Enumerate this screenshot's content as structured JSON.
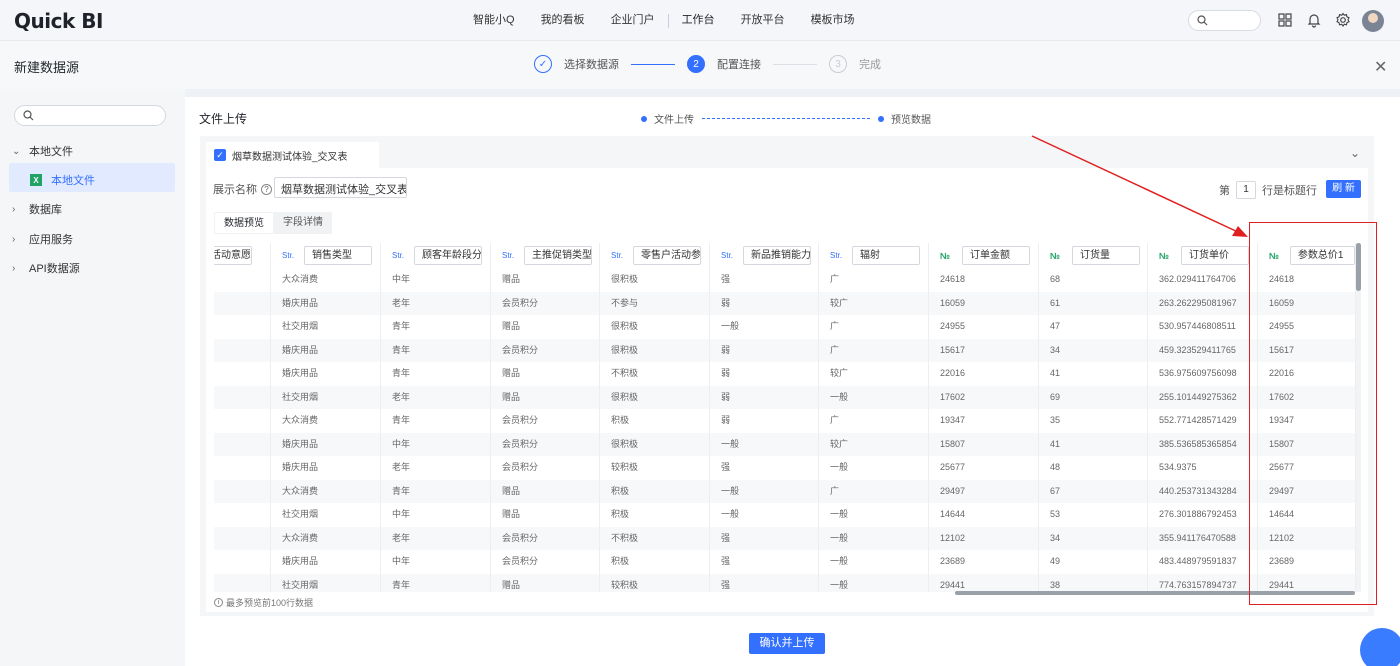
{
  "app": {
    "logo": "Quick BI"
  },
  "nav": {
    "items": [
      "智能小Q",
      "我的看板",
      "企业门户",
      "工作台",
      "开放平台",
      "模板市场"
    ],
    "active": "工作台"
  },
  "dialog": {
    "title": "新建数据源",
    "steps": [
      {
        "num": "✓",
        "label": "选择数据源",
        "state": "done"
      },
      {
        "num": "2",
        "label": "配置连接",
        "state": "current"
      },
      {
        "num": "3",
        "label": "完成",
        "state": "todo"
      }
    ],
    "close_icon": "close-icon"
  },
  "sidebar": {
    "search_placeholder": "",
    "items": [
      {
        "label": "本地文件",
        "expanded": true
      },
      {
        "label": "本地文件",
        "child": true,
        "selected": true,
        "icon": "excel-icon"
      },
      {
        "label": "数据库"
      },
      {
        "label": "应用服务"
      },
      {
        "label": "API数据源"
      }
    ]
  },
  "main": {
    "title": "文件上传",
    "subflow": [
      "文件上传",
      "预览数据"
    ],
    "sheet_name": "烟草数据测试体验_交叉表",
    "display_label": "展示名称",
    "display_value": "烟草数据测试体验_交叉表",
    "header_row": {
      "prefix": "第",
      "value": "1",
      "suffix": "行是标题行"
    },
    "refresh": "刷 新",
    "tabs": [
      "数据预览",
      "字段详情"
    ],
    "active_tab": "数据预览",
    "footnote": "最多预览前100行数据",
    "confirm": "确认并上传"
  },
  "table": {
    "columns": [
      {
        "type": "",
        "name": "促销活动意愿"
      },
      {
        "type": "Str.",
        "name": "销售类型"
      },
      {
        "type": "Str.",
        "name": "顾客年龄段分"
      },
      {
        "type": "Str.",
        "name": "主推促销类型"
      },
      {
        "type": "Str.",
        "name": "零售户活动参"
      },
      {
        "type": "Str.",
        "name": "新品推销能力"
      },
      {
        "type": "Str.",
        "name": "辐射"
      },
      {
        "type": "№",
        "name": "订单金额"
      },
      {
        "type": "№",
        "name": "订货量"
      },
      {
        "type": "№",
        "name": "订货单价"
      },
      {
        "type": "№",
        "name": "参数总价1"
      }
    ],
    "rows": [
      [
        "",
        "大众消费",
        "中年",
        "赠品",
        "很积极",
        "强",
        "广",
        "24618",
        "68",
        "362.029411764706",
        "24618"
      ],
      [
        "",
        "婚庆用品",
        "老年",
        "会员积分",
        "不参与",
        "弱",
        "较广",
        "16059",
        "61",
        "263.262295081967",
        "16059"
      ],
      [
        "",
        "社交用烟",
        "青年",
        "赠品",
        "很积极",
        "一般",
        "广",
        "24955",
        "47",
        "530.957446808511",
        "24955"
      ],
      [
        "",
        "婚庆用品",
        "青年",
        "会员积分",
        "很积极",
        "弱",
        "广",
        "15617",
        "34",
        "459.323529411765",
        "15617"
      ],
      [
        "",
        "婚庆用品",
        "青年",
        "赠品",
        "不积极",
        "弱",
        "较广",
        "22016",
        "41",
        "536.975609756098",
        "22016"
      ],
      [
        "",
        "社交用烟",
        "老年",
        "赠品",
        "很积极",
        "弱",
        "一般",
        "17602",
        "69",
        "255.101449275362",
        "17602"
      ],
      [
        "",
        "大众消费",
        "青年",
        "会员积分",
        "积极",
        "弱",
        "广",
        "19347",
        "35",
        "552.771428571429",
        "19347"
      ],
      [
        "",
        "婚庆用品",
        "中年",
        "会员积分",
        "很积极",
        "一般",
        "较广",
        "15807",
        "41",
        "385.536585365854",
        "15807"
      ],
      [
        "",
        "婚庆用品",
        "老年",
        "会员积分",
        "较积极",
        "强",
        "一般",
        "25677",
        "48",
        "534.9375",
        "25677"
      ],
      [
        "",
        "大众消费",
        "青年",
        "赠品",
        "积极",
        "一般",
        "广",
        "29497",
        "67",
        "440.253731343284",
        "29497"
      ],
      [
        "",
        "社交用烟",
        "中年",
        "赠品",
        "积极",
        "一般",
        "一般",
        "14644",
        "53",
        "276.301886792453",
        "14644"
      ],
      [
        "",
        "大众消费",
        "老年",
        "会员积分",
        "不积极",
        "强",
        "一般",
        "12102",
        "34",
        "355.941176470588",
        "12102"
      ],
      [
        "",
        "婚庆用品",
        "中年",
        "会员积分",
        "积极",
        "强",
        "一般",
        "23689",
        "49",
        "483.448979591837",
        "23689"
      ],
      [
        "",
        "社交用烟",
        "青年",
        "赠品",
        "较积极",
        "强",
        "一般",
        "29441",
        "38",
        "774.763157894737",
        "29441"
      ]
    ]
  },
  "colors": {
    "accent": "#3370ff",
    "annotation": "#e02020"
  }
}
